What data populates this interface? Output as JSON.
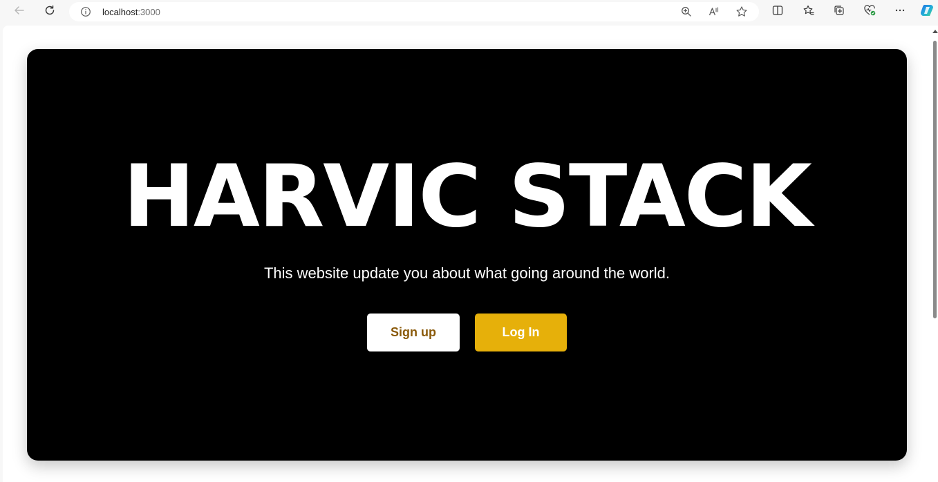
{
  "browser": {
    "address": {
      "host": "localhost",
      "port": ":3000"
    },
    "icons": {
      "back": "arrow-left-icon",
      "refresh": "refresh-icon",
      "info": "info-icon",
      "zoom": "zoom-icon",
      "read_aloud": "read-aloud-icon",
      "favorite": "star-icon",
      "split_screen": "split-screen-icon",
      "favorites": "favorites-icon",
      "collections": "collections-icon",
      "performance": "heart-pulse-icon",
      "more": "more-icon",
      "copilot": "copilot-icon"
    }
  },
  "hero": {
    "title": "HARVIC STACK",
    "subtitle": "This website update you about what going around the world.",
    "signup_label": "Sign up",
    "login_label": "Log In"
  },
  "colors": {
    "hero_background": "#000000",
    "login_button": "#e6b00a",
    "signup_text": "#8a5a0a"
  }
}
